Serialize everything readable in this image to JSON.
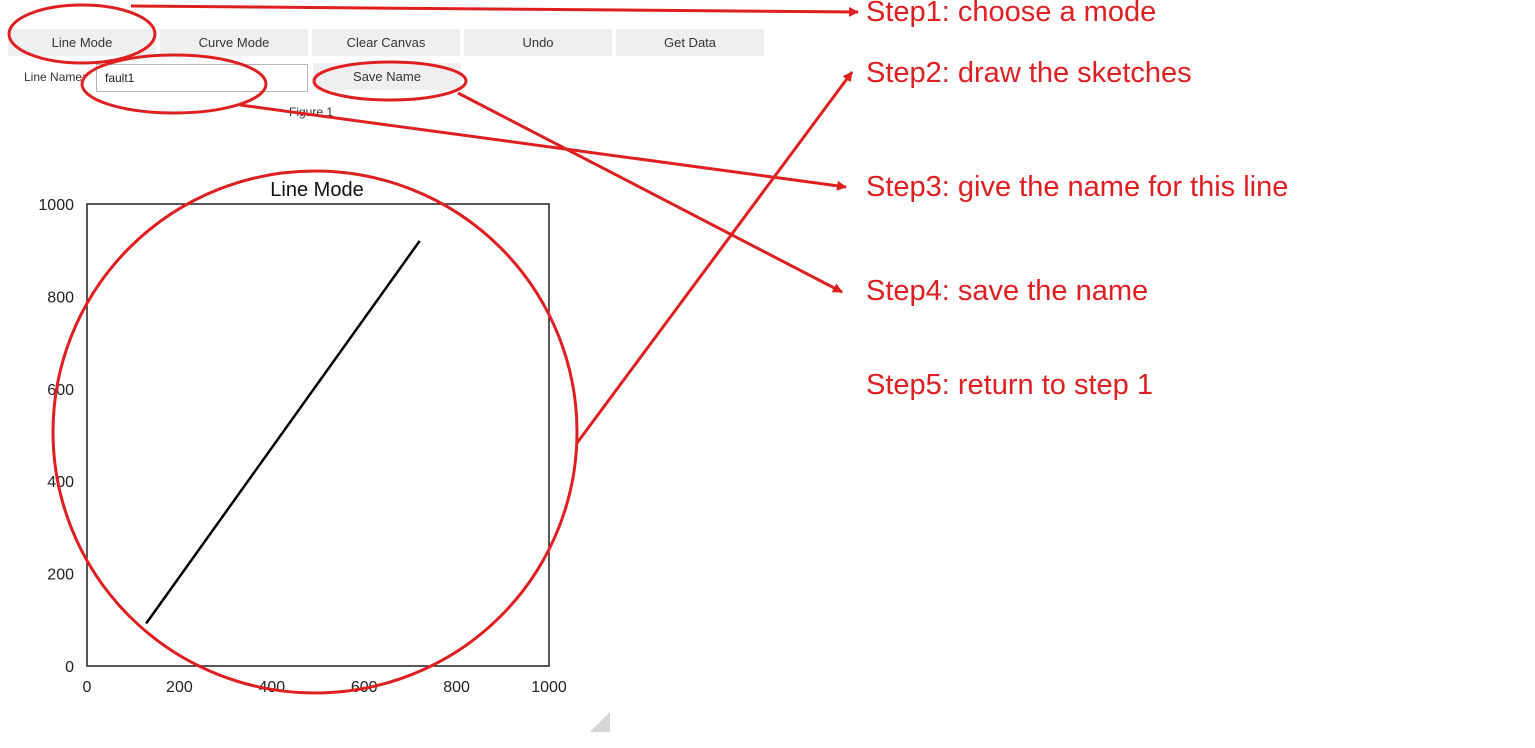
{
  "toolbar": {
    "line_mode_label": "Line Mode",
    "curve_mode_label": "Curve Mode",
    "clear_canvas_label": "Clear Canvas",
    "undo_label": "Undo",
    "get_data_label": "Get Data"
  },
  "name_row": {
    "label": "Line Name:",
    "input_value": "fault1",
    "save_label": "Save Name"
  },
  "figure": {
    "label": "Figure 1"
  },
  "chart_data": {
    "type": "line",
    "title": "Line Mode",
    "xlabel": "",
    "ylabel": "",
    "xlim": [
      0,
      1000
    ],
    "ylim": [
      0,
      1000
    ],
    "xticks": [
      "0",
      "200",
      "400",
      "600",
      "800",
      "1000"
    ],
    "yticks": [
      "0",
      "200",
      "400",
      "600",
      "800",
      "1000"
    ],
    "grid": false,
    "series": [
      {
        "x": [
          128,
          720
        ],
        "y": [
          92,
          920
        ],
        "color": "#000000"
      }
    ]
  },
  "annotations": {
    "color": "#e02020",
    "steps": [
      "Step1: choose a mode",
      "Step2: draw the sketches",
      "Step3: give the name for  this line",
      "Step4: save the name",
      "Step5: return to step 1"
    ]
  }
}
